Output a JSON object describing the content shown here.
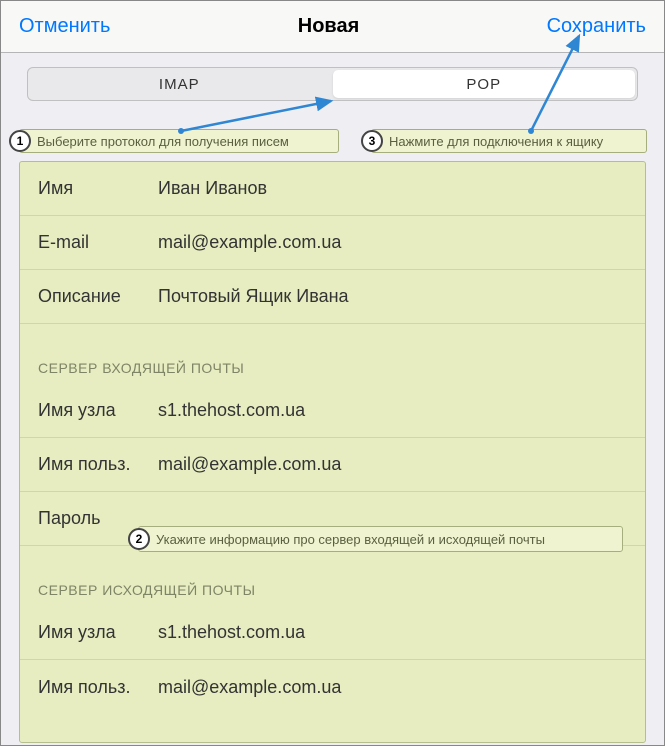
{
  "navbar": {
    "cancel": "Отменить",
    "title": "Новая",
    "save": "Сохранить"
  },
  "segmented": {
    "imap": "IMAP",
    "pop": "POP"
  },
  "callouts": {
    "c1": {
      "num": "1",
      "text": "Выберите протокол для получения писем"
    },
    "c2": {
      "num": "2",
      "text": "Укажите информацию про сервер входящей и исходящей почты"
    },
    "c3": {
      "num": "3",
      "text": "Нажмите для подключения к ящику"
    }
  },
  "account": {
    "name_label": "Имя",
    "name_value": "Иван Иванов",
    "email_label": "E-mail",
    "email_value": "mail@example.com.ua",
    "desc_label": "Описание",
    "desc_value": "Почтовый Ящик Ивана"
  },
  "incoming": {
    "header": "СЕРВЕР ВХОДЯЩЕЙ ПОЧТЫ",
    "host_label": "Имя узла",
    "host_value": "s1.thehost.com.ua",
    "user_label": "Имя польз.",
    "user_value": "mail@example.com.ua",
    "pass_label": "Пароль"
  },
  "outgoing": {
    "header": "СЕРВЕР ИСХОДЯЩЕЙ ПОЧТЫ",
    "host_label": "Имя узла",
    "host_value": "s1.thehost.com.ua",
    "user_label": "Имя польз.",
    "user_value": "mail@example.com.ua"
  }
}
